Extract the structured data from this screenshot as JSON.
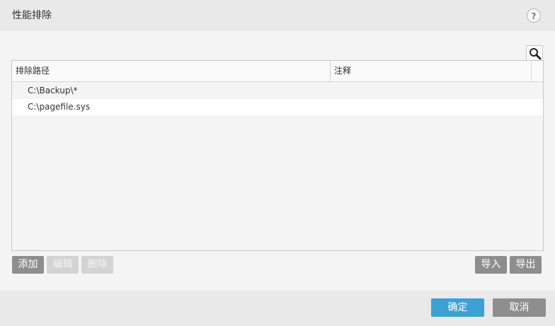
{
  "dialog": {
    "title": "性能排除",
    "help_label": "?"
  },
  "table": {
    "columns": [
      "排除路径",
      "注释"
    ],
    "rows": [
      {
        "path": "C:\\Backup\\*",
        "comment": ""
      },
      {
        "path": "C:\\pagefile.sys",
        "comment": ""
      }
    ]
  },
  "toolbar": {
    "add_label": "添加",
    "edit_label": "编辑",
    "delete_label": "删除",
    "import_label": "导入",
    "export_label": "导出"
  },
  "footer": {
    "ok_label": "确定",
    "cancel_label": "取消"
  },
  "colors": {
    "accent": "#3da1d4",
    "button_gray": "#8e8e8e",
    "button_disabled": "#d3d3d3"
  },
  "icons": {
    "search": "search-icon"
  }
}
